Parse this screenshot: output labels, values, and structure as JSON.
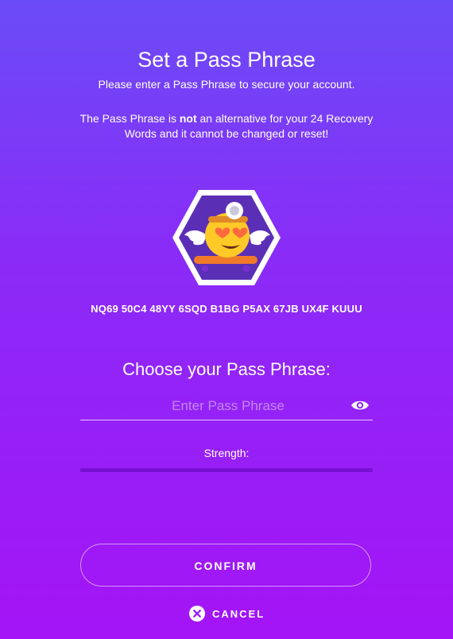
{
  "header": {
    "title": "Set a Pass Phrase",
    "subtitle": "Please enter a Pass Phrase to secure your account.",
    "warning_prefix": "The Pass Phrase is ",
    "warning_emphasis": "not",
    "warning_suffix": " an alternative for your 24 Recovery Words and it cannot be changed or reset!"
  },
  "account": {
    "avatar_icon": "flying-skateboard-emoji-avatar-icon",
    "address": "NQ69 50C4 48YY 6SQD B1BG P5AX 67JB UX4F KUUU"
  },
  "form": {
    "heading": "Choose your Pass Phrase:",
    "input_value": "",
    "input_placeholder": "Enter Pass Phrase",
    "visibility_icon": "eye-icon",
    "strength_label": "Strength:",
    "strength_value": 0
  },
  "actions": {
    "confirm_label": "CONFIRM",
    "cancel_label": "CANCEL",
    "cancel_icon": "close-circle-icon"
  },
  "colors": {
    "bg_top": "#6a4cf7",
    "bg_bottom": "#a414f6",
    "avatar_bg": "#5a2fb6",
    "avatar_border": "#ffffff"
  }
}
